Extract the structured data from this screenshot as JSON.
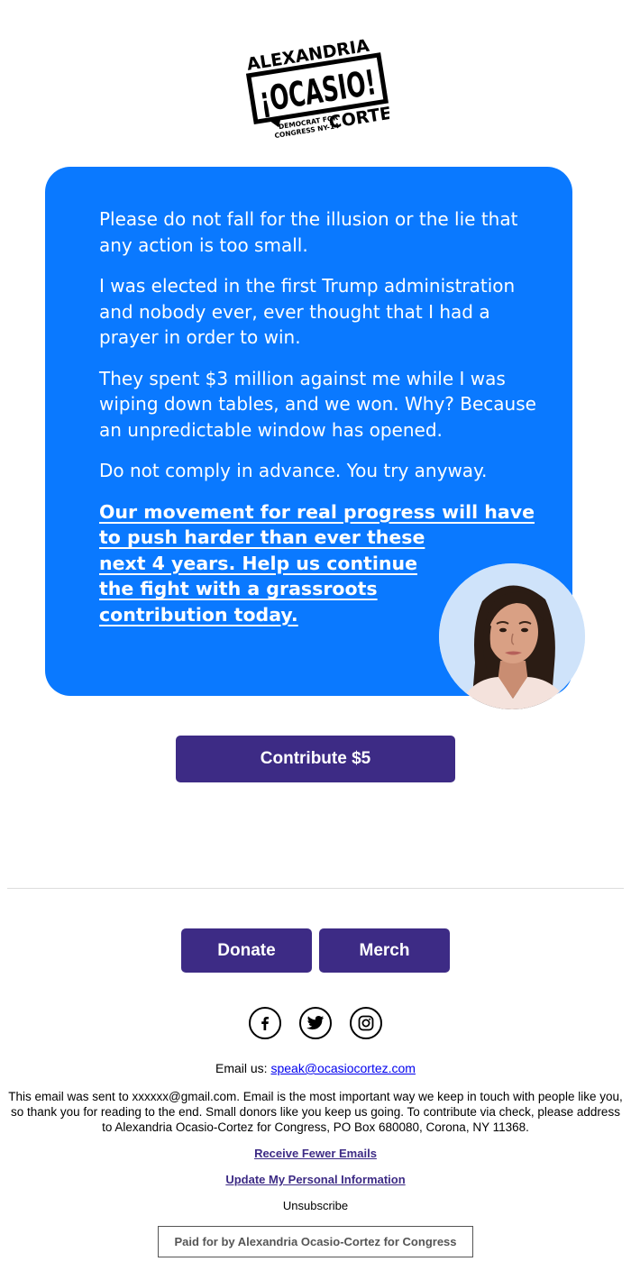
{
  "logo": {
    "top_text": "ALEXANDRIA",
    "main_text": "¡OCASIO!",
    "sub_line_1": "DEMOCRAT FOR",
    "sub_line_2": "CONGRESS NY-14",
    "bottom_text": "CORTEZ"
  },
  "card": {
    "background": "#0a79ff",
    "paragraphs": [
      "Please do not fall for the illusion or the lie that any action is too small.",
      "I was elected in the first Trump administration and nobody ever, ever thought that I had a prayer in order to win.",
      "They spent $3 million against me while I was wiping down tables, and we won. Why? Because an unpredictable window has opened.",
      "Do not comply in advance. You try anyway."
    ],
    "cta_lines": [
      "Our movement for real progress will have",
      "to push harder than ever these",
      "next 4 years. Help us continue",
      "the fight with a grassroots",
      "contribution today."
    ]
  },
  "buttons": {
    "contribute_label": "Contribute $5",
    "donate_label": "Donate",
    "merch_label": "Merch",
    "color": "#3d2b85"
  },
  "social": {
    "icons": [
      "facebook-icon",
      "twitter-icon",
      "instagram-icon"
    ]
  },
  "footer": {
    "email_prefix": "Email us: ",
    "email_address": "speak@ocasiocortez.com",
    "disclaimer": "This email was sent to xxxxxx@gmail.com. Email is the most important way we keep in touch with people like you, so thank you for reading to the end. Small donors like you keep us going. To contribute via check, please address to Alexandria Ocasio-Cortez for Congress, PO Box 680080, Corona, NY 11368.",
    "fewer_emails": "Receive Fewer Emails",
    "update_info": "Update My Personal Information",
    "unsubscribe": "Unsubscribe",
    "paid_for": "Paid for by Alexandria Ocasio-Cortez for Congress"
  }
}
